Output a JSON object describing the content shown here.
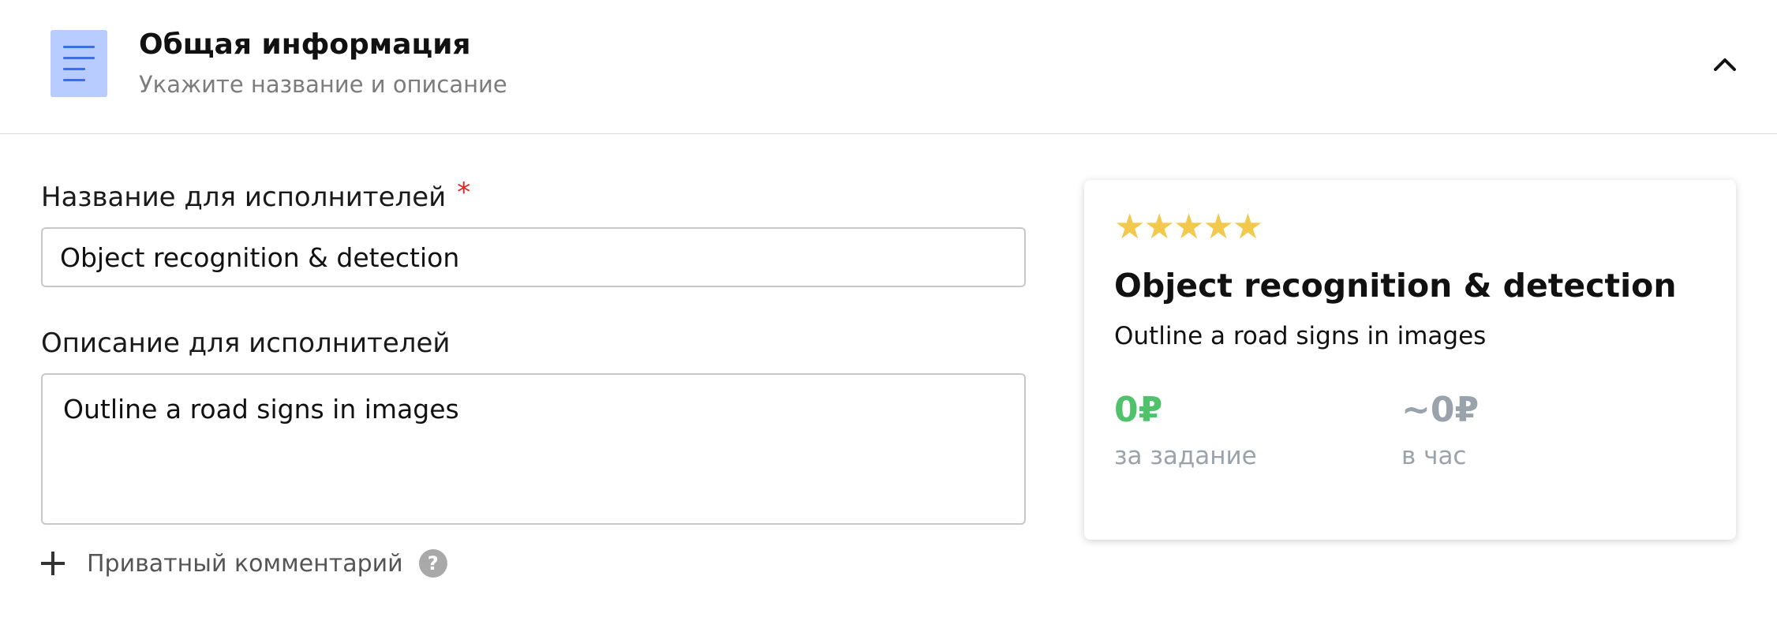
{
  "header": {
    "title": "Общая информация",
    "subtitle": "Укажите название и описание",
    "icon": "document-lines-icon",
    "collapse_icon": "chevron-up-icon"
  },
  "form": {
    "name_label": "Название для исполнителей",
    "required_mark": "*",
    "name_value": "Object recognition & detection",
    "description_label": "Описание для исполнителей",
    "description_value": "Outline a road signs in images",
    "private_comment_label": "Приватный комментарий",
    "help_symbol": "?"
  },
  "preview": {
    "stars": "★★★★★",
    "rating": 5,
    "title": "Object recognition & detection",
    "description": "Outline a road signs in images",
    "price_per_task": "0₽",
    "price_per_task_caption": "за задание",
    "price_per_hour": "~0₽",
    "price_per_hour_caption": "в час"
  },
  "colors": {
    "accent_green": "#4fc26b",
    "required_red": "#e32222",
    "star_yellow": "#f2c94c",
    "icon_blue": "#b8ccff"
  }
}
